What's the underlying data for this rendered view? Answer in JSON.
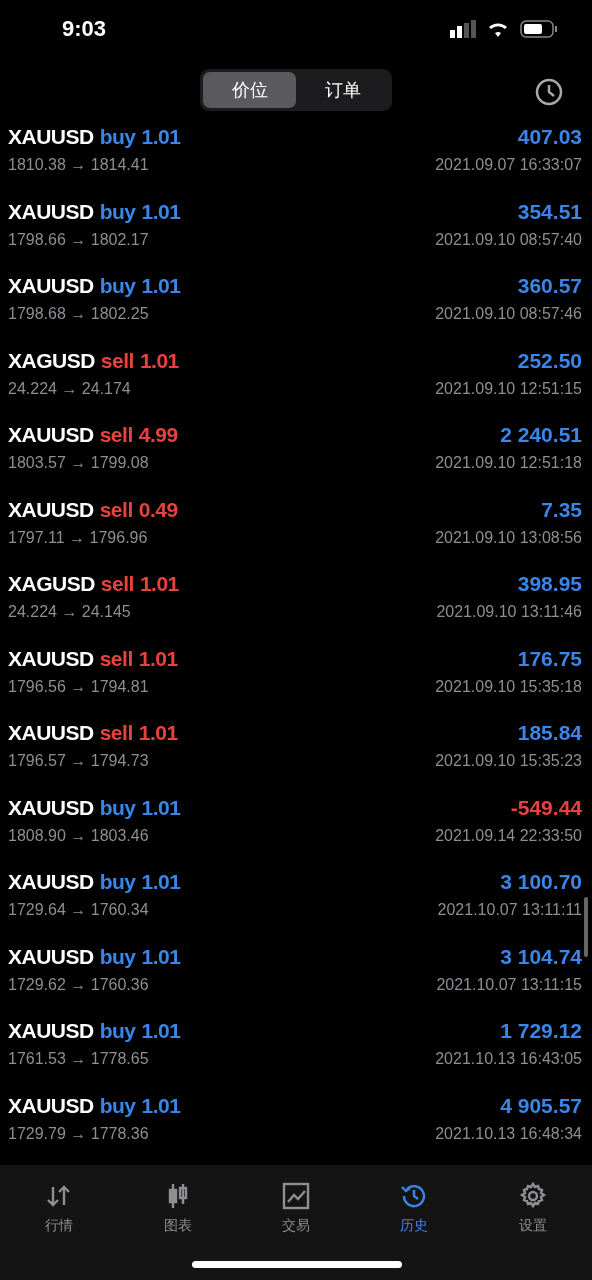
{
  "status_bar": {
    "time": "9:03"
  },
  "segments": [
    {
      "label": "价位",
      "selected": true
    },
    {
      "label": "订单",
      "selected": false
    }
  ],
  "trades": [
    {
      "symbol": "XAUUSD",
      "side": "buy",
      "kind": "buy",
      "volume": "1.01",
      "prices": "1810.38 → 1814.41",
      "profit": "407.03",
      "loss": false,
      "time": "2021.09.07 16:33:07"
    },
    {
      "symbol": "XAUUSD",
      "side": "buy",
      "kind": "buy",
      "volume": "1.01",
      "prices": "1798.66 → 1802.17",
      "profit": "354.51",
      "loss": false,
      "time": "2021.09.10 08:57:40"
    },
    {
      "symbol": "XAUUSD",
      "side": "buy",
      "kind": "buy",
      "volume": "1.01",
      "prices": "1798.68 → 1802.25",
      "profit": "360.57",
      "loss": false,
      "time": "2021.09.10 08:57:46"
    },
    {
      "symbol": "XAGUSD",
      "side": "sell",
      "kind": "sell",
      "volume": "1.01",
      "prices": "24.224 → 24.174",
      "profit": "252.50",
      "loss": false,
      "time": "2021.09.10 12:51:15"
    },
    {
      "symbol": "XAUUSD",
      "side": "sell",
      "kind": "sell",
      "volume": "4.99",
      "prices": "1803.57 → 1799.08",
      "profit": "2 240.51",
      "loss": false,
      "time": "2021.09.10 12:51:18"
    },
    {
      "symbol": "XAUUSD",
      "side": "sell",
      "kind": "sell",
      "volume": "0.49",
      "prices": "1797.11 → 1796.96",
      "profit": "7.35",
      "loss": false,
      "time": "2021.09.10 13:08:56"
    },
    {
      "symbol": "XAGUSD",
      "side": "sell",
      "kind": "sell",
      "volume": "1.01",
      "prices": "24.224 → 24.145",
      "profit": "398.95",
      "loss": false,
      "time": "2021.09.10 13:11:46"
    },
    {
      "symbol": "XAUUSD",
      "side": "sell",
      "kind": "sell",
      "volume": "1.01",
      "prices": "1796.56 → 1794.81",
      "profit": "176.75",
      "loss": false,
      "time": "2021.09.10 15:35:18"
    },
    {
      "symbol": "XAUUSD",
      "side": "sell",
      "kind": "sell",
      "volume": "1.01",
      "prices": "1796.57 → 1794.73",
      "profit": "185.84",
      "loss": false,
      "time": "2021.09.10 15:35:23"
    },
    {
      "symbol": "XAUUSD",
      "side": "buy",
      "kind": "buy",
      "volume": "1.01",
      "prices": "1808.90 → 1803.46",
      "profit": "-549.44",
      "loss": true,
      "time": "2021.09.14 22:33:50"
    },
    {
      "symbol": "XAUUSD",
      "side": "buy",
      "kind": "buy",
      "volume": "1.01",
      "prices": "1729.64 → 1760.34",
      "profit": "3 100.70",
      "loss": false,
      "time": "2021.10.07 13:11:11"
    },
    {
      "symbol": "XAUUSD",
      "side": "buy",
      "kind": "buy",
      "volume": "1.01",
      "prices": "1729.62 → 1760.36",
      "profit": "3 104.74",
      "loss": false,
      "time": "2021.10.07 13:11:15"
    },
    {
      "symbol": "XAUUSD",
      "side": "buy",
      "kind": "buy",
      "volume": "1.01",
      "prices": "1761.53 → 1778.65",
      "profit": "1 729.12",
      "loss": false,
      "time": "2021.10.13 16:43:05"
    },
    {
      "symbol": "XAUUSD",
      "side": "buy",
      "kind": "buy",
      "volume": "1.01",
      "prices": "1729.79 → 1778.36",
      "profit": "4 905.57",
      "loss": false,
      "time": "2021.10.13 16:48:34"
    }
  ],
  "tab_bar": [
    {
      "label": "行情",
      "kind": "quotes",
      "selected": false
    },
    {
      "label": "图表",
      "kind": "chart",
      "selected": false
    },
    {
      "label": "交易",
      "kind": "trade",
      "selected": false
    },
    {
      "label": "历史",
      "kind": "history",
      "selected": true
    },
    {
      "label": "设置",
      "kind": "settings",
      "selected": false
    }
  ]
}
